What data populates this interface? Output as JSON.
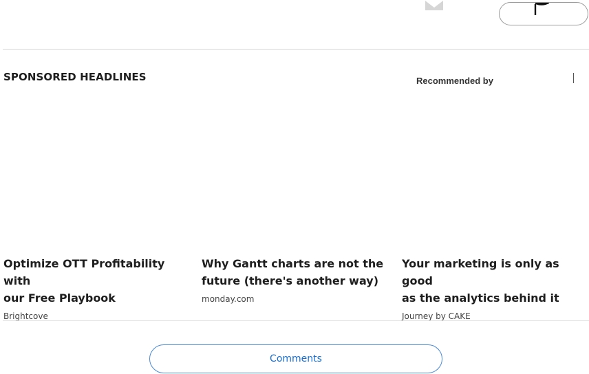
{
  "header": {
    "mail_icon": "mail-icon",
    "report_icon": "flag-icon"
  },
  "sponsored": {
    "title": "SPONSORED HEADLINES",
    "recommended_label": "Recommended by",
    "cards": [
      {
        "title_line1": "Optimize OTT Profitability with",
        "title_line2": "our Free Playbook",
        "source": "Brightcove"
      },
      {
        "title_line1": "Why Gantt charts are not the",
        "title_line2": "future (there's another way)",
        "source": "monday.com"
      },
      {
        "title_line1": "Your marketing is only as good",
        "title_line2": "as the analytics behind it",
        "source": "Journey by CAKE"
      }
    ]
  },
  "comments": {
    "button_label": "Comments"
  },
  "colors": {
    "accent": "#1a6fd3",
    "border": "#4a8ad6",
    "divider": "#d4d4d4"
  }
}
